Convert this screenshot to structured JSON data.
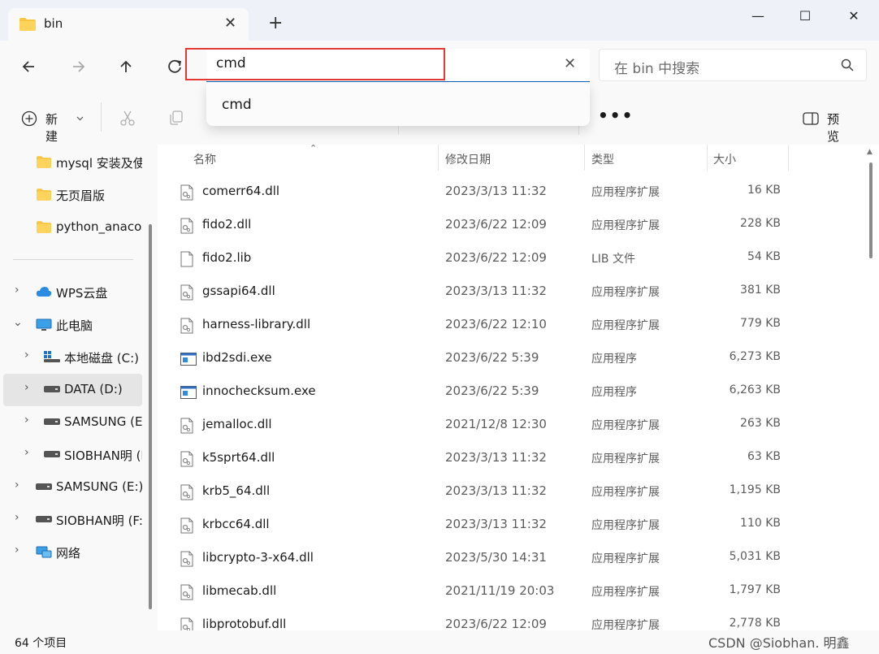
{
  "window": {
    "tab_title": "bin",
    "new_tab_symbol": "+",
    "minimize_symbol": "—",
    "maximize_symbol": "☐",
    "close_symbol": "✕"
  },
  "address_bar": {
    "value": "cmd",
    "clear_symbol": "✕"
  },
  "suggestion": {
    "item": "cmd"
  },
  "search": {
    "placeholder": "在 bin 中搜索"
  },
  "command_bar": {
    "new_label": "新建",
    "more_symbol": "•••",
    "preview_label": "预览"
  },
  "sidebar": {
    "items": [
      {
        "label": "mysql 安装及使",
        "icon": "folder-icon"
      },
      {
        "label": "无页眉版",
        "icon": "folder-icon"
      },
      {
        "label": "python_anacor",
        "icon": "folder-icon"
      },
      {
        "label": "WPS云盘",
        "icon": "cloud-icon"
      },
      {
        "label": "此电脑",
        "icon": "pc-icon"
      },
      {
        "label": "本地磁盘 (C:)",
        "icon": "windows-drive-icon"
      },
      {
        "label": "DATA (D:)",
        "icon": "drive-icon"
      },
      {
        "label": "SAMSUNG (E",
        "icon": "drive-icon"
      },
      {
        "label": "SIOBHAN明 (I",
        "icon": "drive-icon"
      },
      {
        "label": "SAMSUNG (E:)",
        "icon": "drive-icon"
      },
      {
        "label": "SIOBHAN明 (F:)",
        "icon": "drive-icon"
      },
      {
        "label": "网络",
        "icon": "network-icon"
      }
    ]
  },
  "columns": {
    "name": "名称",
    "date": "修改日期",
    "type": "类型",
    "size": "大小"
  },
  "files": [
    {
      "name": "comerr64.dll",
      "date": "2023/3/13 11:32",
      "type": "应用程序扩展",
      "size": "16 KB",
      "kind": "dll"
    },
    {
      "name": "fido2.dll",
      "date": "2023/6/22 12:09",
      "type": "应用程序扩展",
      "size": "228 KB",
      "kind": "dll"
    },
    {
      "name": "fido2.lib",
      "date": "2023/6/22 12:09",
      "type": "LIB 文件",
      "size": "54 KB",
      "kind": "file"
    },
    {
      "name": "gssapi64.dll",
      "date": "2023/3/13 11:32",
      "type": "应用程序扩展",
      "size": "381 KB",
      "kind": "dll"
    },
    {
      "name": "harness-library.dll",
      "date": "2023/6/22 12:10",
      "type": "应用程序扩展",
      "size": "779 KB",
      "kind": "dll"
    },
    {
      "name": "ibd2sdi.exe",
      "date": "2023/6/22 5:39",
      "type": "应用程序",
      "size": "6,273 KB",
      "kind": "exe"
    },
    {
      "name": "innochecksum.exe",
      "date": "2023/6/22 5:39",
      "type": "应用程序",
      "size": "6,263 KB",
      "kind": "exe"
    },
    {
      "name": "jemalloc.dll",
      "date": "2021/12/8 12:30",
      "type": "应用程序扩展",
      "size": "263 KB",
      "kind": "dll"
    },
    {
      "name": "k5sprt64.dll",
      "date": "2023/3/13 11:32",
      "type": "应用程序扩展",
      "size": "63 KB",
      "kind": "dll"
    },
    {
      "name": "krb5_64.dll",
      "date": "2023/3/13 11:32",
      "type": "应用程序扩展",
      "size": "1,195 KB",
      "kind": "dll"
    },
    {
      "name": "krbcc64.dll",
      "date": "2023/3/13 11:32",
      "type": "应用程序扩展",
      "size": "110 KB",
      "kind": "dll"
    },
    {
      "name": "libcrypto-3-x64.dll",
      "date": "2023/5/30 14:31",
      "type": "应用程序扩展",
      "size": "5,031 KB",
      "kind": "dll"
    },
    {
      "name": "libmecab.dll",
      "date": "2021/11/19 20:03",
      "type": "应用程序扩展",
      "size": "1,797 KB",
      "kind": "dll"
    },
    {
      "name": "libprotobuf.dll",
      "date": "2023/6/22 12:09",
      "type": "应用程序扩展",
      "size": "2,778 KB",
      "kind": "dll"
    }
  ],
  "status": {
    "item_count": "64 个项目"
  },
  "watermark": "CSDN @Siobhan. 明鑫"
}
